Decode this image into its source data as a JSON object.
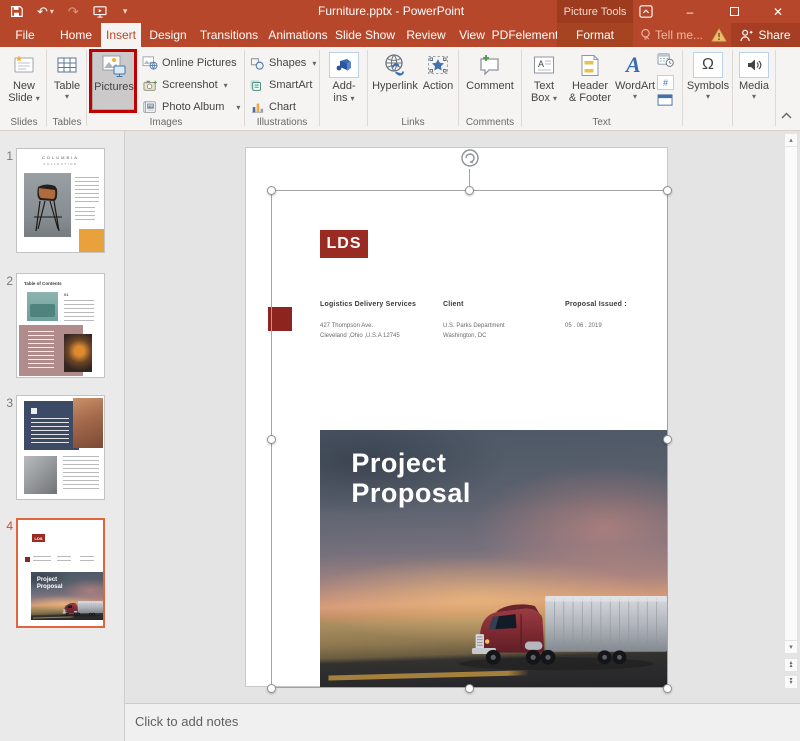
{
  "window": {
    "title": "Furniture.pptx - PowerPoint",
    "contextual_label": "Picture Tools"
  },
  "tabs": {
    "items": [
      "File",
      "Home",
      "Insert",
      "Design",
      "Transitions",
      "Animations",
      "Slide Show",
      "Review",
      "View",
      "PDFelement"
    ],
    "active": "Insert",
    "contextual_format": "Format",
    "tell_me": "Tell me...",
    "share": "Share"
  },
  "ribbon": {
    "buttons": {
      "new_slide": "New Slide",
      "table": "Table",
      "pictures": "Pictures",
      "online_pictures": "Online Pictures",
      "screenshot": "Screenshot",
      "photo_album": "Photo Album",
      "shapes": "Shapes",
      "smartart": "SmartArt",
      "chart": "Chart",
      "addins": "Add-ins",
      "hyperlink": "Hyperlink",
      "action": "Action",
      "comment": "Comment",
      "text_box": "Text Box",
      "header_footer": "Header & Footer",
      "wordart": "WordArt",
      "symbols": "Symbols",
      "media": "Media"
    },
    "group_labels": {
      "slides": "Slides",
      "tables": "Tables",
      "images": "Images",
      "illustrations": "Illustrations",
      "links": "Links",
      "comments": "Comments",
      "text": "Text"
    }
  },
  "icons": {
    "caret": "▾",
    "caret_up": "▴",
    "caret_down": "▾",
    "omega": "Ω",
    "minimize": "–",
    "close": "✕",
    "undo": "↶",
    "redo": "↷",
    "warning_mark": "!",
    "hash": "#"
  },
  "thumbnails": {
    "items": [
      {
        "number": "1",
        "selected": false,
        "title_line1": "COLUMBIA",
        "title_line2": "COLLECTION"
      },
      {
        "number": "2",
        "selected": false,
        "title": "Table of Contents",
        "section": "01"
      },
      {
        "number": "3",
        "selected": false
      },
      {
        "number": "4",
        "selected": true,
        "logo": "LDS",
        "caption": "Project Proposal"
      }
    ]
  },
  "slide": {
    "logo": "LDS",
    "info_columns": [
      {
        "header": "Logistics Delivery Services",
        "lines": [
          "427 Thompson Ave.",
          "Cleveland ,Ohio ,U.S.A 12745"
        ]
      },
      {
        "header": "Client",
        "lines": [
          "U.S. Parks Department",
          "Washington, DC"
        ]
      },
      {
        "header": "Proposal Issued :",
        "lines": [
          "05 . 06 . 2019"
        ]
      }
    ],
    "hero": {
      "line1": "Project",
      "line2": "Proposal"
    }
  },
  "notes": {
    "placeholder": "Click to add notes"
  },
  "colors": {
    "titlebar": "#B7472A",
    "contextual_band": "#9E3A1D",
    "format_tab_bg": "#A64320",
    "share_bg": "#A53E22",
    "annotation_box": "#C00000",
    "brand_red": "#9A2B22",
    "thumb_selected_border": "#E0643C",
    "orange_block": "#E9A13B",
    "mauve_block": "#B18C8C",
    "navy_block": "#3D4A66"
  }
}
